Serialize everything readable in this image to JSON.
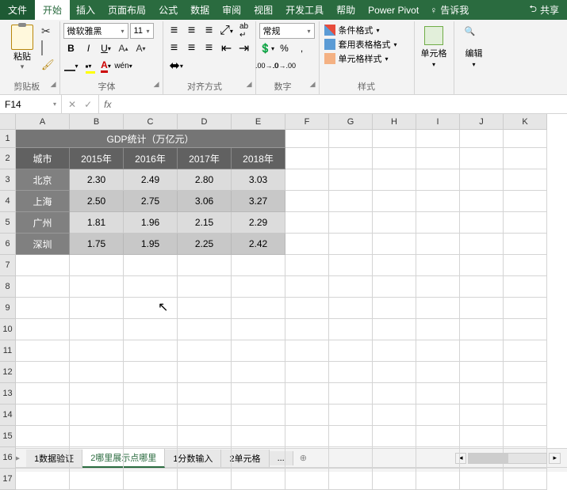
{
  "tabs": {
    "file": "文件",
    "home": "开始",
    "insert": "插入",
    "layout": "页面布局",
    "formula": "公式",
    "data": "数据",
    "review": "审阅",
    "view": "视图",
    "dev": "开发工具",
    "help": "帮助",
    "pivot": "Power Pivot",
    "tellme": "告诉我",
    "share": "共享"
  },
  "ribbon": {
    "clipboard": {
      "label": "剪贴板",
      "paste": "粘贴"
    },
    "font": {
      "label": "字体",
      "name": "微软雅黑",
      "size": "11"
    },
    "align": {
      "label": "对齐方式"
    },
    "number": {
      "label": "数字",
      "format": "常规"
    },
    "styles": {
      "label": "样式",
      "cond": "条件格式",
      "table": "套用表格格式",
      "cell": "单元格样式"
    },
    "cells": {
      "label": "单元格"
    },
    "edit": {
      "label": "编辑"
    }
  },
  "namebox": "F14",
  "cols": [
    "A",
    "B",
    "C",
    "D",
    "E",
    "F",
    "G",
    "H",
    "I",
    "J",
    "K"
  ],
  "rows": [
    "1",
    "2",
    "3",
    "4",
    "5",
    "6",
    "7",
    "8",
    "9",
    "10",
    "11",
    "12",
    "13",
    "14",
    "15",
    "16",
    "17"
  ],
  "table": {
    "title": "GDP统计（万亿元）",
    "corner": "城市",
    "years": [
      "2015年",
      "2016年",
      "2017年",
      "2018年"
    ],
    "cities": [
      "北京",
      "上海",
      "广州",
      "深圳"
    ],
    "values": [
      [
        "2.30",
        "2.49",
        "2.80",
        "3.03"
      ],
      [
        "2.50",
        "2.75",
        "3.06",
        "3.27"
      ],
      [
        "1.81",
        "1.96",
        "2.15",
        "2.29"
      ],
      [
        "1.75",
        "1.95",
        "2.25",
        "2.42"
      ]
    ]
  },
  "sheets": {
    "s1": "1数据验证",
    "s2": "2哪里展示点哪里",
    "s3": "1分数输入",
    "s4": "2单元格",
    "more": "..."
  },
  "chart_data": {
    "type": "table",
    "title": "GDP统计（万亿元）",
    "xlabel": "城市",
    "categories": [
      "2015年",
      "2016年",
      "2017年",
      "2018年"
    ],
    "series": [
      {
        "name": "北京",
        "values": [
          2.3,
          2.49,
          2.8,
          3.03
        ]
      },
      {
        "name": "上海",
        "values": [
          2.5,
          2.75,
          3.06,
          3.27
        ]
      },
      {
        "name": "广州",
        "values": [
          1.81,
          1.96,
          2.15,
          2.29
        ]
      },
      {
        "name": "深圳",
        "values": [
          1.75,
          1.95,
          2.25,
          2.42
        ]
      }
    ]
  }
}
